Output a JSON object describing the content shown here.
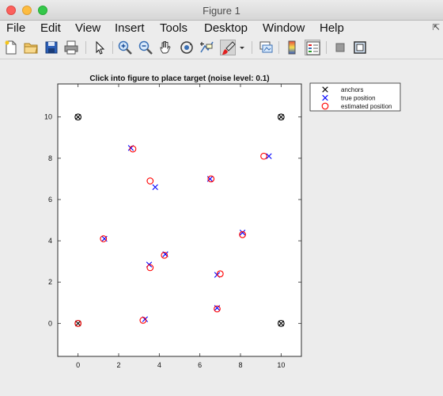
{
  "window": {
    "title": "Figure 1"
  },
  "menu": [
    "File",
    "Edit",
    "View",
    "Insert",
    "Tools",
    "Desktop",
    "Window",
    "Help"
  ],
  "toolbar": {
    "icons": [
      "new-file-icon",
      "open-folder-icon",
      "save-icon",
      "print-icon",
      "pointer-icon",
      "zoom-in-icon",
      "zoom-out-icon",
      "pan-hand-icon",
      "rotate-3d-icon",
      "data-cursor-icon",
      "brush-icon",
      "brush-dropdown-icon",
      "link-plot-icon",
      "colorbar-icon",
      "legend-icon",
      "hide-plot-tools-icon",
      "show-plot-tools-icon"
    ]
  },
  "chart_data": {
    "type": "scatter",
    "title": "Click into figure to place target (noise level: 0.1)",
    "xlabel": "",
    "ylabel": "",
    "xlim": [
      -1,
      11
    ],
    "ylim": [
      -1.6,
      11.6
    ],
    "xticks": [
      0,
      2,
      4,
      6,
      8,
      10
    ],
    "yticks": [
      0,
      2,
      4,
      6,
      8,
      10
    ],
    "grid": false,
    "legend_position": "outside-top-right",
    "series": [
      {
        "name": "anchors",
        "marker": "x-circle",
        "color": "#000000",
        "points": [
          [
            0,
            0
          ],
          [
            10,
            0
          ],
          [
            0,
            10
          ],
          [
            10,
            10
          ]
        ]
      },
      {
        "name": "true position",
        "marker": "x",
        "color": "#0000ff",
        "points": [
          [
            1.3,
            4.1
          ],
          [
            2.6,
            8.5
          ],
          [
            3.8,
            6.6
          ],
          [
            3.5,
            2.85
          ],
          [
            4.3,
            3.35
          ],
          [
            3.3,
            0.2
          ],
          [
            6.5,
            7.0
          ],
          [
            6.85,
            2.35
          ],
          [
            8.1,
            4.4
          ],
          [
            9.4,
            8.1
          ],
          [
            6.85,
            0.75
          ]
        ]
      },
      {
        "name": "estimated position",
        "marker": "circle",
        "color": "#ff0000",
        "points": [
          [
            1.25,
            4.1
          ],
          [
            2.7,
            8.45
          ],
          [
            3.55,
            6.9
          ],
          [
            3.55,
            2.7
          ],
          [
            4.25,
            3.3
          ],
          [
            3.2,
            0.15
          ],
          [
            6.55,
            7.0
          ],
          [
            7.0,
            2.4
          ],
          [
            8.1,
            4.3
          ],
          [
            9.15,
            8.1
          ],
          [
            6.85,
            0.7
          ],
          [
            0,
            0
          ]
        ]
      }
    ]
  }
}
